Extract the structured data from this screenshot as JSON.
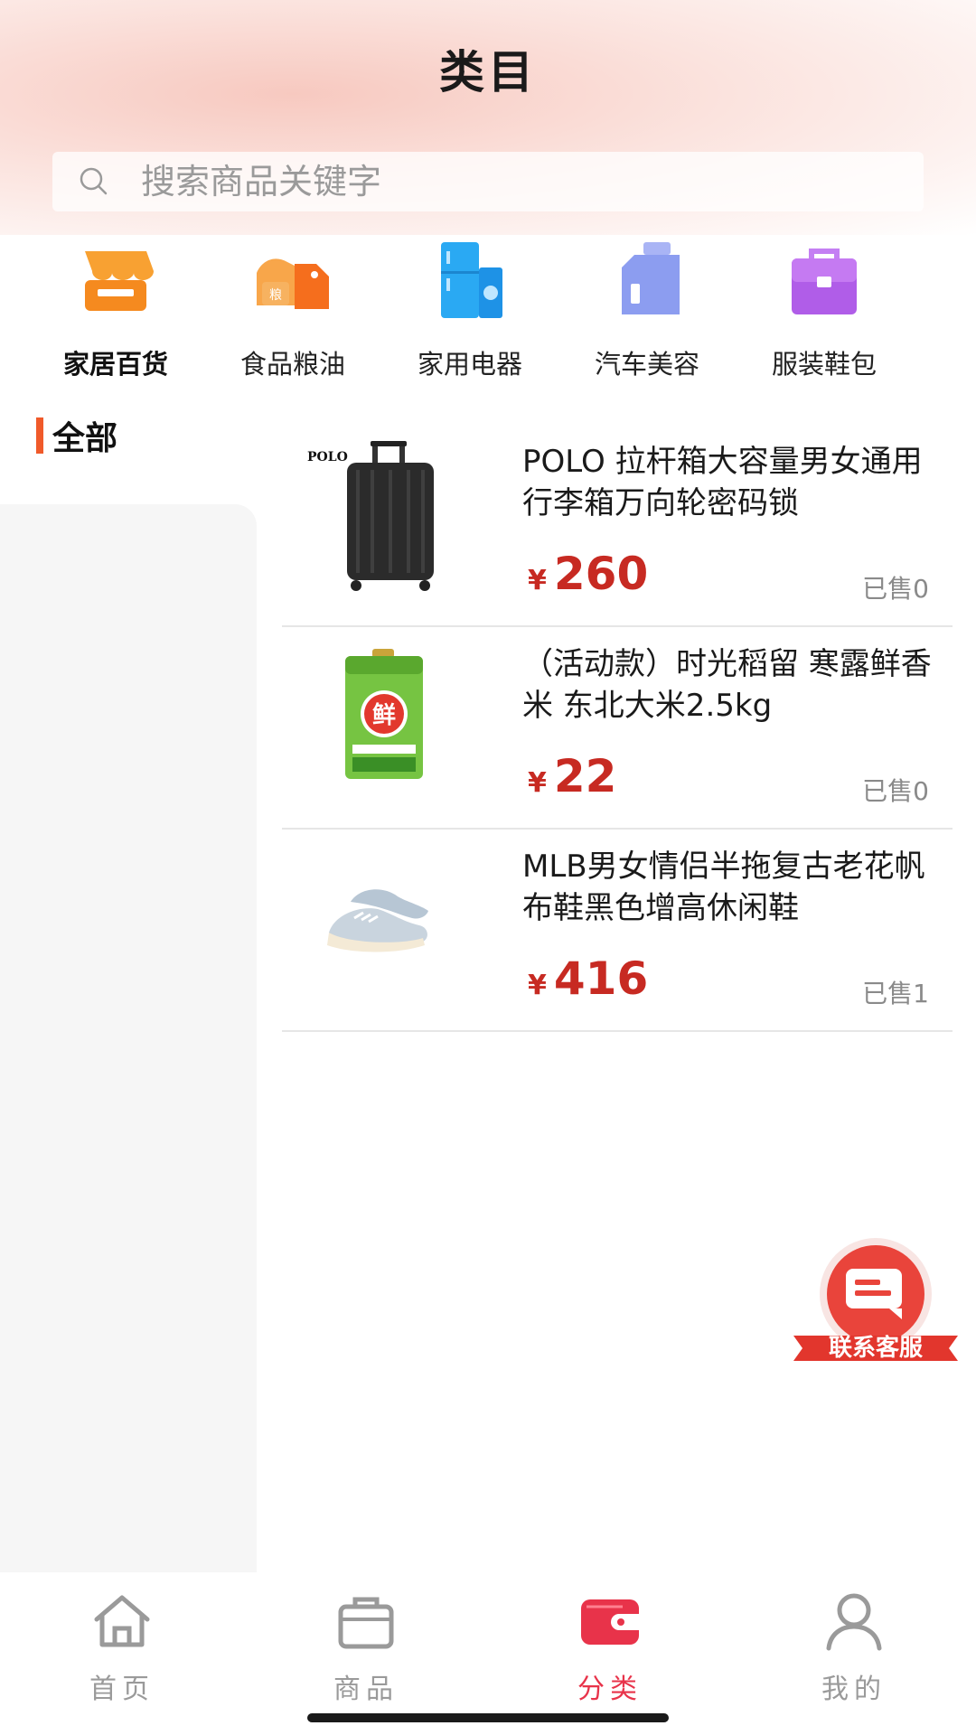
{
  "header": {
    "title": "类目"
  },
  "search": {
    "placeholder": "搜索商品关键字"
  },
  "categories": [
    {
      "label": "家居百货",
      "icon": "storefront-icon",
      "active": true
    },
    {
      "label": "食品粮油",
      "icon": "grain-tag-icon",
      "active": false
    },
    {
      "label": "家用电器",
      "icon": "fridge-washer-icon",
      "active": false
    },
    {
      "label": "汽车美容",
      "icon": "car-care-bottle-icon",
      "active": false
    },
    {
      "label": "服装鞋包",
      "icon": "handbag-icon",
      "active": false
    }
  ],
  "sidebar": {
    "current": "全部"
  },
  "products": [
    {
      "name": "POLO 拉杆箱大容量男女通用行李箱万向轮密码锁",
      "currency": "¥",
      "price": "260",
      "sold": "已售0",
      "image": "suitcase-image",
      "image_brand": "POLO"
    },
    {
      "name": "（活动款）时光稻留 寒露鲜香米 东北大米2.5kg",
      "currency": "¥",
      "price": "22",
      "sold": "已售0",
      "image": "rice-bag-image",
      "image_brand": "鲜"
    },
    {
      "name": "MLB男女情侣半拖复古老花帆布鞋黑色增高休闲鞋",
      "currency": "¥",
      "price": "416",
      "sold": "已售1",
      "image": "sneakers-image"
    }
  ],
  "service_button": {
    "label": "联系客服",
    "icon": "chat-bubble-icon"
  },
  "tabbar": {
    "items": [
      {
        "label": "首页",
        "icon": "home-icon",
        "active": false
      },
      {
        "label": "商品",
        "icon": "bag-icon",
        "active": false
      },
      {
        "label": "分类",
        "icon": "wallet-icon",
        "active": true
      },
      {
        "label": "我的",
        "icon": "user-icon",
        "active": false
      }
    ]
  },
  "colors": {
    "accent": "#e8334a",
    "price": "#c72a22",
    "sidebar_bar": "#f05a2a"
  }
}
